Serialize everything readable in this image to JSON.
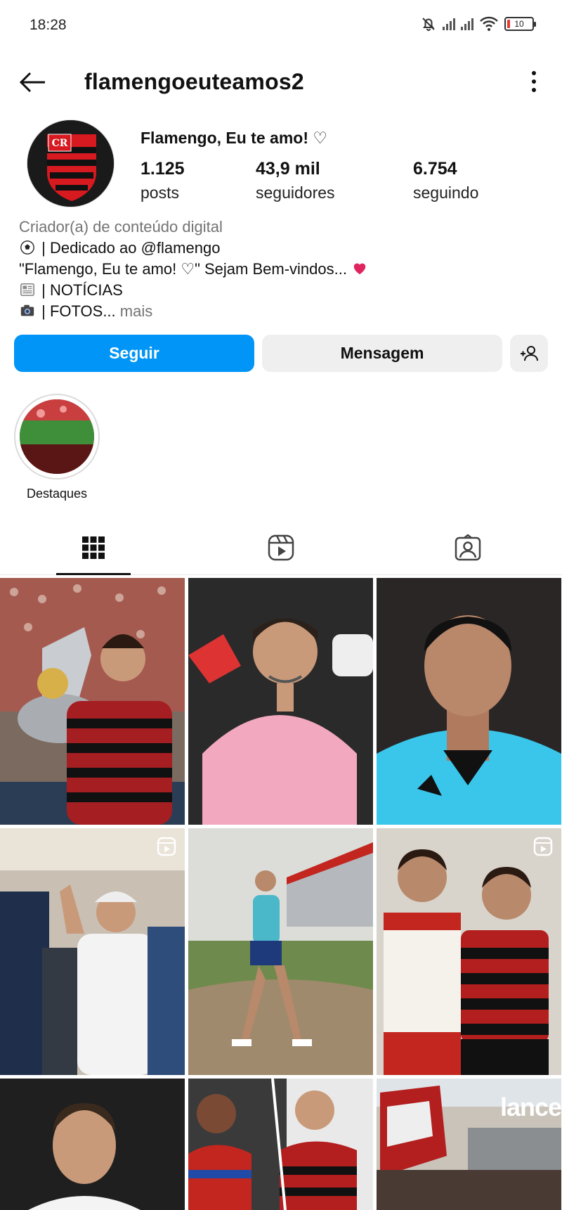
{
  "status_bar": {
    "time": "18:28",
    "battery": "10"
  },
  "header": {
    "username": "flamengoeuteamos2"
  },
  "profile": {
    "display_name": "Flamengo, Eu te amo! ♡",
    "stats": [
      {
        "value": "1.125",
        "label": "posts"
      },
      {
        "value": "43,9 mil",
        "label": "seguidores"
      },
      {
        "value": "6.754",
        "label": "seguindo"
      }
    ],
    "category": "Criador(a) de conteúdo digital",
    "bio_lines": [
      {
        "emoji": "soccer-ball-icon",
        "text": " | Dedicado ao @flamengo"
      },
      {
        "text": "\"Flamengo, Eu te amo! ♡\" Sejam Bem-vindos... "
      },
      {
        "emoji": "newspaper-icon",
        "text": " | NOTÍCIAS"
      },
      {
        "emoji": "camera-icon",
        "text": " | FOTOS... "
      }
    ],
    "more_label": "mais"
  },
  "actions": {
    "follow": "Seguir",
    "message": "Mensagem"
  },
  "highlights": [
    {
      "label": "Destaques"
    }
  ],
  "tabs": [
    "grid-icon",
    "reels-icon",
    "tagged-icon"
  ],
  "colors": {
    "accent": "#0095f6",
    "flamengo_red": "#d71920",
    "flamengo_black": "#111111"
  },
  "posts": [
    {
      "subject": "player kissing trophy",
      "reel": false
    },
    {
      "subject": "man in pink shirt",
      "reel": false
    },
    {
      "subject": "referee portrait",
      "reel": false
    },
    {
      "subject": "player waving in tunnel",
      "reel": true
    },
    {
      "subject": "player walking on training field",
      "reel": false
    },
    {
      "subject": "two kids in jerseys",
      "reel": true
    },
    {
      "subject": "player portrait",
      "reel": false
    },
    {
      "subject": "players celebrating",
      "reel": false
    },
    {
      "subject": "fans with flag",
      "reel": false
    }
  ],
  "post_watermark": "lance"
}
